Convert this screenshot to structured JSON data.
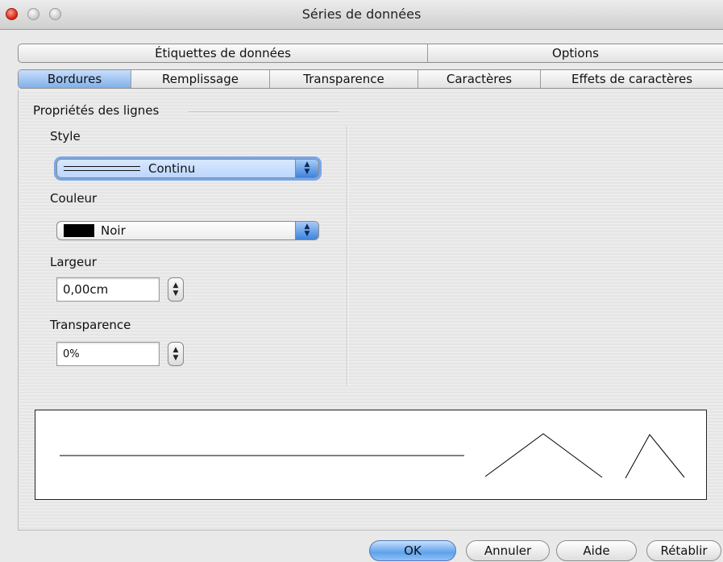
{
  "window": {
    "title": "Séries de données"
  },
  "tabs_row1": [
    {
      "label": "Étiquettes de données"
    },
    {
      "label": "Options"
    }
  ],
  "tabs_row2": [
    {
      "label": "Bordures",
      "selected": true
    },
    {
      "label": "Remplissage"
    },
    {
      "label": "Transparence"
    },
    {
      "label": "Caractères"
    },
    {
      "label": "Effets de caractères"
    }
  ],
  "line_props": {
    "group_title": "Propriétés des lignes",
    "style_label": "Style",
    "style_value": "Continu",
    "color_label": "Couleur",
    "color_value": "Noir",
    "color_hex": "#000000",
    "width_label": "Largeur",
    "width_value": "0,00cm",
    "transparency_label": "Transparence",
    "transparency_value": "0%"
  },
  "buttons": {
    "ok": "OK",
    "cancel": "Annuler",
    "help": "Aide",
    "reset": "Rétablir"
  },
  "colors": {
    "accent": "#5ea2ec",
    "close": "#d71f10"
  }
}
